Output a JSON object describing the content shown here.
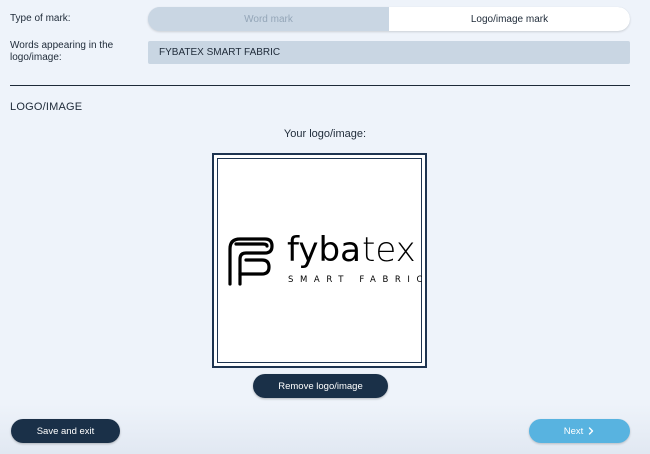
{
  "form": {
    "type_label": "Type of mark:",
    "type_options": [
      {
        "label": "Word mark",
        "selected": false
      },
      {
        "label": "Logo/image mark",
        "selected": true
      }
    ],
    "words_label": "Words appearing in the logo/image:",
    "words_value": "FYBATEX SMART FABRIC"
  },
  "logo_section": {
    "title": "LOGO/IMAGE",
    "your_logo_label": "Your logo/image:",
    "logo": {
      "wordmark_part1": "fyba",
      "wordmark_part2": "tex",
      "tagline": "SMART FABRIC",
      "icon": "fybatex-f-icon"
    },
    "remove_button": "Remove logo/image"
  },
  "footer": {
    "save_button": "Save and exit",
    "next_button": "Next",
    "next_icon": "chevron-right-icon"
  },
  "colors": {
    "background": "#eef3fa",
    "dark_button": "#1a3048",
    "next_button": "#58b3e0",
    "field_bg": "#c9d6e3"
  }
}
